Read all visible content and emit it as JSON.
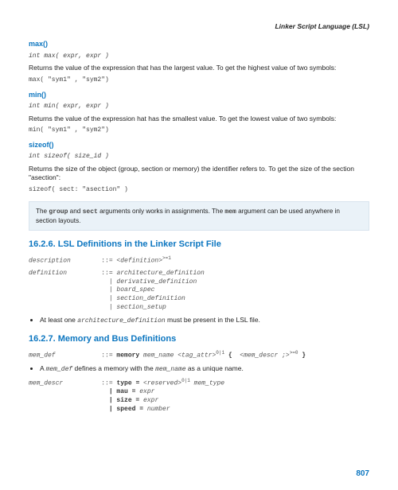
{
  "running_head": "Linker Script Language (LSL)",
  "max": {
    "title": "max()",
    "sig": "int max( expr, expr )",
    "desc": "Returns the value of the expression that has the largest value. To get the highest value of two symbols:",
    "ex": "max( \"sym1\" , \"sym2\")"
  },
  "min": {
    "title": "min()",
    "sig": "int min( expr, expr )",
    "desc": "Returns the value of the expression hat has the smallest value. To get the lowest value of two symbols:",
    "ex": "min( \"sym1\" , \"sym2\")"
  },
  "sizeof": {
    "title": "sizeof()",
    "sig": "int sizeof( size_id )",
    "desc": "Returns the size of the object (group, section or memory) the identifier refers to. To get the size of the section \"asection\":",
    "ex": "sizeof( sect: \"asection\" )"
  },
  "note": {
    "pre": "The ",
    "kw1": "group",
    "mid1": " and ",
    "kw2": "sect",
    "mid2": " arguments only works in assignments. The ",
    "kw3": "mem",
    "post": " argument can be used anywhere in section layouts."
  },
  "sec1626": {
    "title": "16.2.6. LSL Definitions in the Linker Script File",
    "g_desc_lhs": "description",
    "g_desc_op": "::= ",
    "g_desc_rhs": "<definition>",
    "g_desc_sup": ">=1",
    "g_def_lhs": "definition",
    "g_def_op": "::= ",
    "g_def_r1": "architecture_definition",
    "g_def_r2": "| derivative_definition",
    "g_def_r3": "| board_spec",
    "g_def_r4": "| section_definition",
    "g_def_r5": "| section_setup",
    "bul_pre": "At least one ",
    "bul_code": "architecture_definition",
    "bul_post": " must be present in the LSL file."
  },
  "sec1627": {
    "title": "16.2.7. Memory and Bus Definitions",
    "mem_def_lhs": "mem_def",
    "mem_def_op": "::= ",
    "mem_def_kw": "memory",
    "mem_def_name": " mem_name <tag_attr>",
    "mem_def_sup1": "0|1",
    "mem_def_brace": " { ",
    "mem_def_descr": " <mem_descr ;>",
    "mem_def_sup2": ">=0",
    "mem_def_end": " }",
    "bul_pre": "A ",
    "bul_c1": "mem_def",
    "bul_mid": " defines a memory with the ",
    "bul_c2": "mem_name",
    "bul_post": " as a unique name.",
    "md_lhs": "mem_descr",
    "md_op": "::= ",
    "md_kw_type": "type = ",
    "md_res": "<reserved>",
    "md_res_sup": "0|1",
    "md_type_it": " mem_type",
    "md_r2_kw": "| mau = ",
    "md_r2_it": "expr",
    "md_r3_kw": "| size = ",
    "md_r3_it": "expr",
    "md_r4_kw": "| speed = ",
    "md_r4_it": "number"
  },
  "pagenum": "807"
}
